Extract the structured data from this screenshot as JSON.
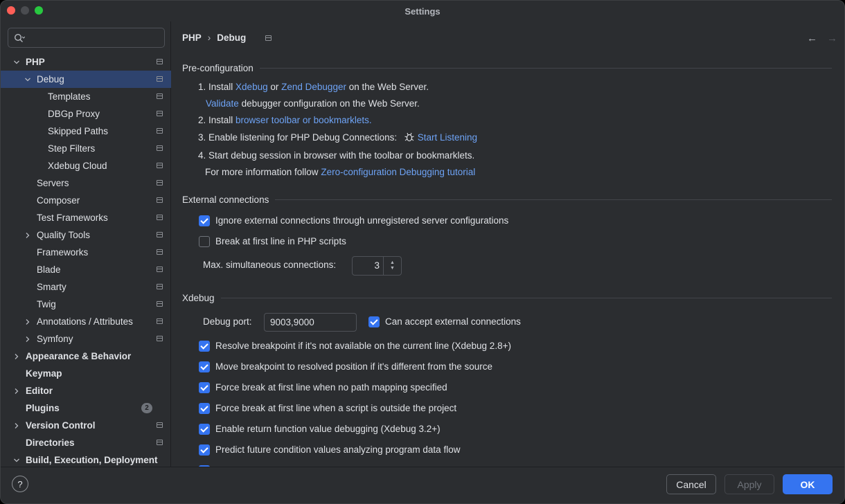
{
  "window": {
    "title": "Settings"
  },
  "search": {
    "placeholder": ""
  },
  "tree": [
    {
      "label": "PHP",
      "depth": 0,
      "bold": true,
      "chevron": "down",
      "pin": true
    },
    {
      "label": "Debug",
      "depth": 1,
      "chevron": "down",
      "pin": true,
      "selected": true
    },
    {
      "label": "Templates",
      "depth": 2,
      "pin": true
    },
    {
      "label": "DBGp Proxy",
      "depth": 2,
      "pin": true
    },
    {
      "label": "Skipped Paths",
      "depth": 2,
      "pin": true
    },
    {
      "label": "Step Filters",
      "depth": 2,
      "pin": true
    },
    {
      "label": "Xdebug Cloud",
      "depth": 2,
      "pin": true
    },
    {
      "label": "Servers",
      "depth": 1,
      "pin": true
    },
    {
      "label": "Composer",
      "depth": 1,
      "pin": true
    },
    {
      "label": "Test Frameworks",
      "depth": 1,
      "pin": true
    },
    {
      "label": "Quality Tools",
      "depth": 1,
      "chevron": "right",
      "pin": true
    },
    {
      "label": "Frameworks",
      "depth": 1,
      "pin": true
    },
    {
      "label": "Blade",
      "depth": 1,
      "pin": true
    },
    {
      "label": "Smarty",
      "depth": 1,
      "pin": true
    },
    {
      "label": "Twig",
      "depth": 1,
      "pin": true
    },
    {
      "label": "Annotations / Attributes",
      "depth": 1,
      "chevron": "right",
      "pin": true
    },
    {
      "label": "Symfony",
      "depth": 1,
      "chevron": "right",
      "pin": true
    },
    {
      "label": "Appearance & Behavior",
      "depth": 0,
      "bold": true,
      "chevron": "right"
    },
    {
      "label": "Keymap",
      "depth": 0,
      "bold": true
    },
    {
      "label": "Editor",
      "depth": 0,
      "bold": true,
      "chevron": "right"
    },
    {
      "label": "Plugins",
      "depth": 0,
      "bold": true,
      "badge": "2"
    },
    {
      "label": "Version Control",
      "depth": 0,
      "bold": true,
      "chevron": "right",
      "pin": true
    },
    {
      "label": "Directories",
      "depth": 0,
      "bold": true,
      "pin": true
    },
    {
      "label": "Build, Execution, Deployment",
      "depth": 0,
      "bold": true,
      "chevron": "down"
    }
  ],
  "breadcrumb": {
    "parent": "PHP",
    "separator": "›",
    "current": "Debug"
  },
  "preconfig": {
    "title": "Pre-configuration",
    "step1_prefix": "1. Install",
    "step1_link1": "Xdebug",
    "step1_or": "or",
    "step1_link2": "Zend Debugger",
    "step1_suffix": "on the Web Server.",
    "validate_link": "Validate",
    "validate_suffix": "debugger configuration on the Web Server.",
    "step2_prefix": "2. Install",
    "step2_link": "browser toolbar or bookmarklets.",
    "step3_prefix": "3. Enable listening for PHP Debug Connections:",
    "step3_link": "Start Listening",
    "step4": "4. Start debug session in browser with the toolbar or bookmarklets.",
    "more_prefix": "For more information follow",
    "more_link": "Zero-configuration Debugging tutorial"
  },
  "external": {
    "title": "External connections",
    "ignore_label": "Ignore external connections through unregistered server configurations",
    "ignore_checked": true,
    "break_label": "Break at first line in PHP scripts",
    "break_checked": false,
    "max_label": "Max. simultaneous connections:",
    "max_value": "3"
  },
  "xdebug": {
    "title": "Xdebug",
    "port_label": "Debug port:",
    "port_value": "9003,9000",
    "accept_label": "Can accept external connections",
    "options": [
      "Resolve breakpoint if it's not available on the current line (Xdebug 2.8+)",
      "Move breakpoint to resolved position if it's different from the source",
      "Force break at first line when no path mapping specified",
      "Force break at first line when a script is outside the project",
      "Enable return function value debugging (Xdebug 3.2+)",
      "Predict future condition values analyzing program data flow"
    ]
  },
  "footer": {
    "help": "?",
    "cancel": "Cancel",
    "apply": "Apply",
    "ok": "OK"
  }
}
